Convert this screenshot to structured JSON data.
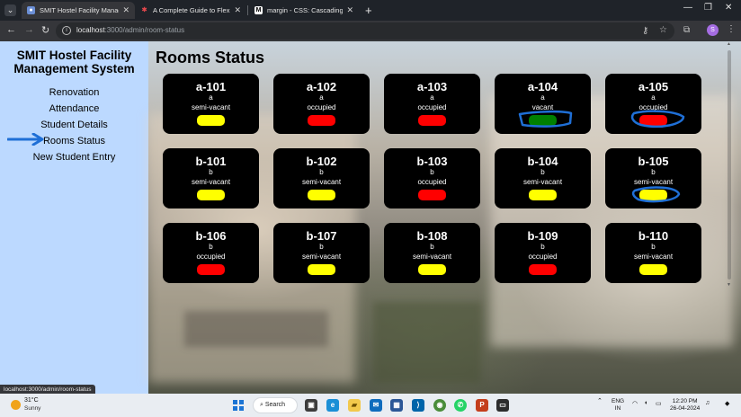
{
  "browser": {
    "tabs": [
      {
        "title": "SMIT Hostel Facility Manageme",
        "active": true
      },
      {
        "title": "A Complete Guide to Flexbox |",
        "active": false
      },
      {
        "title": "margin - CSS: Cascading Style S",
        "active": false
      }
    ],
    "url_host": "localhost",
    "url_path": ":3000/admin/room-status",
    "profile_initial": "S",
    "status_url": "localhost:3000/admin/room-status"
  },
  "sidebar": {
    "title": "SMIT Hostel Facility Management System",
    "items": [
      {
        "label": "Renovation"
      },
      {
        "label": "Attendance"
      },
      {
        "label": "Student Details"
      },
      {
        "label": "Rooms Status",
        "current": true
      },
      {
        "label": "New Student Entry"
      }
    ]
  },
  "main": {
    "heading": "Rooms Status",
    "rooms": [
      {
        "room": "a-101",
        "block": "a",
        "status": "semi-vacant",
        "color": "yellow"
      },
      {
        "room": "a-102",
        "block": "a",
        "status": "occupied",
        "color": "red"
      },
      {
        "room": "a-103",
        "block": "a",
        "status": "occupied",
        "color": "red"
      },
      {
        "room": "a-104",
        "block": "a",
        "status": "vacant",
        "color": "green"
      },
      {
        "room": "a-105",
        "block": "a",
        "status": "occupied",
        "color": "red"
      },
      {
        "room": "b-101",
        "block": "b",
        "status": "semi-vacant",
        "color": "yellow"
      },
      {
        "room": "b-102",
        "block": "b",
        "status": "semi-vacant",
        "color": "yellow"
      },
      {
        "room": "b-103",
        "block": "b",
        "status": "occupied",
        "color": "red"
      },
      {
        "room": "b-104",
        "block": "b",
        "status": "semi-vacant",
        "color": "yellow"
      },
      {
        "room": "b-105",
        "block": "b",
        "status": "semi-vacant",
        "color": "yellow"
      },
      {
        "room": "b-106",
        "block": "b",
        "status": "occupied",
        "color": "red"
      },
      {
        "room": "b-107",
        "block": "b",
        "status": "semi-vacant",
        "color": "yellow"
      },
      {
        "room": "b-108",
        "block": "b",
        "status": "semi-vacant",
        "color": "yellow"
      },
      {
        "room": "b-109",
        "block": "b",
        "status": "occupied",
        "color": "red"
      },
      {
        "room": "b-110",
        "block": "b",
        "status": "semi-vacant",
        "color": "yellow"
      }
    ]
  },
  "taskbar": {
    "weather_temp": "31°C",
    "weather_condition": "Sunny",
    "search_label": "Search",
    "language_line1": "ENG",
    "language_line2": "IN",
    "time": "12:20 PM",
    "date": "26-04-2024"
  },
  "colors": {
    "sidebar_bg": "#bcd9ff",
    "status_yellow": "#ffff00",
    "status_red": "#ff0000",
    "status_green": "#008000",
    "annotation_blue": "#1f6fd6"
  }
}
